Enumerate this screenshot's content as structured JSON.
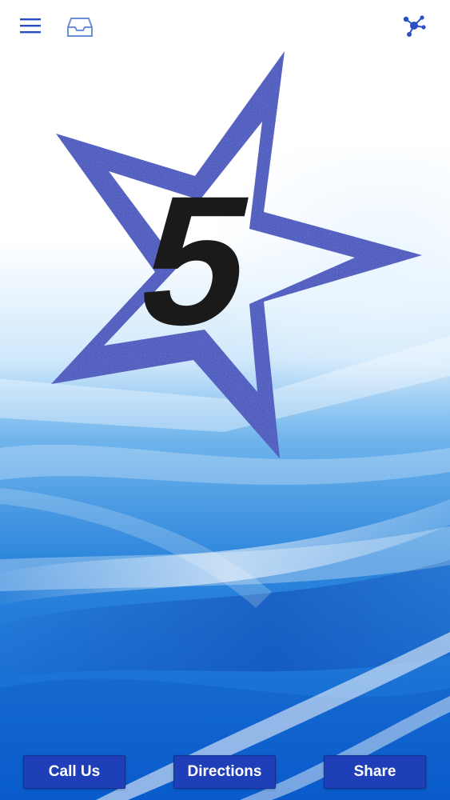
{
  "header": {
    "menu_icon": "hamburger-menu-icon",
    "inbox_icon": "inbox-tray-icon",
    "share_icon": "network-share-icon"
  },
  "logo": {
    "text": "5",
    "shape": "six-point-star-outline",
    "star_color": "#1e3ec2",
    "digit_color": "#1a1a1a"
  },
  "actions": {
    "call_label": "Call Us",
    "directions_label": "Directions",
    "share_label": "Share"
  },
  "colors": {
    "icon_blue": "#2b4fc7",
    "button_blue": "#1f3fb8",
    "background_light": "#ffffff",
    "background_dark": "#0a5fd0"
  }
}
